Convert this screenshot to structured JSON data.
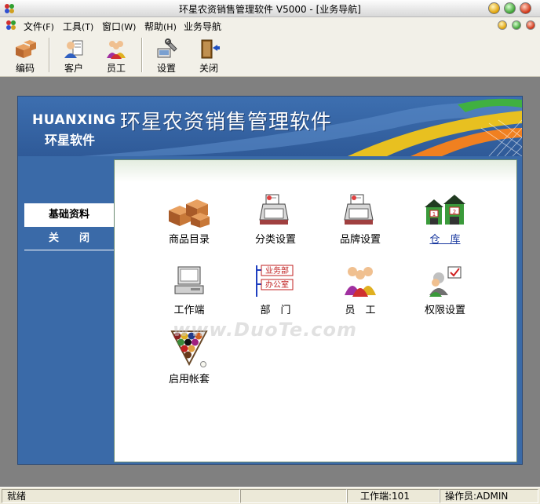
{
  "window": {
    "title": "环星农资销售管理软件 V5000 - [业务导航]"
  },
  "menu": [
    {
      "label": "文件",
      "acc": "(F)"
    },
    {
      "label": "工具",
      "acc": "(T)"
    },
    {
      "label": "窗口",
      "acc": "(W)"
    },
    {
      "label": "帮助",
      "acc": "(H)"
    },
    {
      "label": "业务导航",
      "acc": ""
    }
  ],
  "toolbar": [
    {
      "label": "编码",
      "icon": "boxes-icon"
    },
    {
      "label": "客户",
      "icon": "customer-icon"
    },
    {
      "label": "员工",
      "icon": "staff-icon"
    },
    {
      "label": "设置",
      "icon": "settings-icon"
    },
    {
      "label": "关闭",
      "icon": "exit-door-icon"
    }
  ],
  "banner": {
    "en": "HUANXING",
    "cn_small": "环星软件",
    "cn_big": "环星农资销售管理软件"
  },
  "sidebar": {
    "items": [
      {
        "label": "基础资料",
        "active": true
      },
      {
        "label": "关　　闭",
        "active": false
      }
    ]
  },
  "nav_items": [
    {
      "label": "商品目录",
      "icon": "goods-boxes-icon",
      "link": false
    },
    {
      "label": "分类设置",
      "icon": "category-printer-icon",
      "link": false
    },
    {
      "label": "品牌设置",
      "icon": "brand-printer-icon",
      "link": false
    },
    {
      "label": "仓　库",
      "icon": "warehouse-icon",
      "link": true
    },
    {
      "label": "工作端",
      "icon": "computer-icon",
      "link": false
    },
    {
      "label": "部　门",
      "icon": "department-icon",
      "link": false
    },
    {
      "label": "员　工",
      "icon": "employees-icon",
      "link": false
    },
    {
      "label": "权限设置",
      "icon": "permission-icon",
      "link": false
    },
    {
      "label": "启用帐套",
      "icon": "billiard-rack-icon",
      "link": false
    }
  ],
  "department_icon_text": [
    "业务部",
    "办公室"
  ],
  "watermark": "www.DuoTe.com",
  "status": {
    "ready": "就绪",
    "workstation": "工作端:101",
    "operator": "操作员:ADMIN"
  },
  "colors": {
    "banner_blue": "#3a6aa8",
    "link_blue": "#1a3aa0"
  }
}
